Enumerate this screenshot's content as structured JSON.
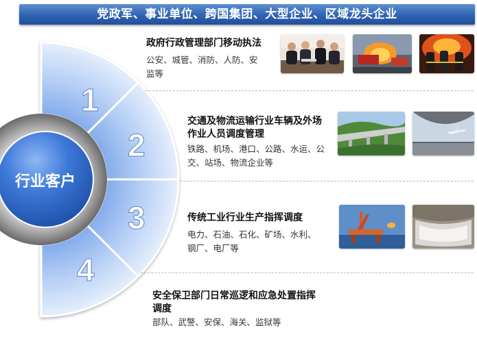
{
  "banner": {
    "text": "党政军、事业单位、跨国集团、大型企业、区域龙头企业"
  },
  "center_label": "行业客户",
  "segments": [
    {
      "number": "1",
      "title_lines": [
        "政府行政管理部门移动执法"
      ],
      "desc_lines": [
        "公安、城管、消防、人防、安",
        "监等"
      ]
    },
    {
      "number": "2",
      "title_lines": [
        "交通及物流运输行业车辆及外场",
        "作业人员调度管理"
      ],
      "desc_lines": [
        "铁路、机场、港口、公路、水运、公",
        "交、站场、物流企业等"
      ]
    },
    {
      "number": "3",
      "title_lines": [
        "传统工业行业生产指挥调度"
      ],
      "desc_lines": [
        "电力、石油、石化、矿场、水利、",
        "钢厂、电厂等"
      ]
    },
    {
      "number": "4",
      "title_lines": [
        "安全保卫部门日常巡逻和应急处置指挥",
        "调度"
      ],
      "desc_lines": [
        "部队、武警、安保、海关、监狱等"
      ]
    }
  ],
  "colors": {
    "banner": "#2f63b3",
    "fan_light": "#dbe8fb",
    "fan_dark": "#9dbdf0",
    "center": "#2f6bd0"
  }
}
